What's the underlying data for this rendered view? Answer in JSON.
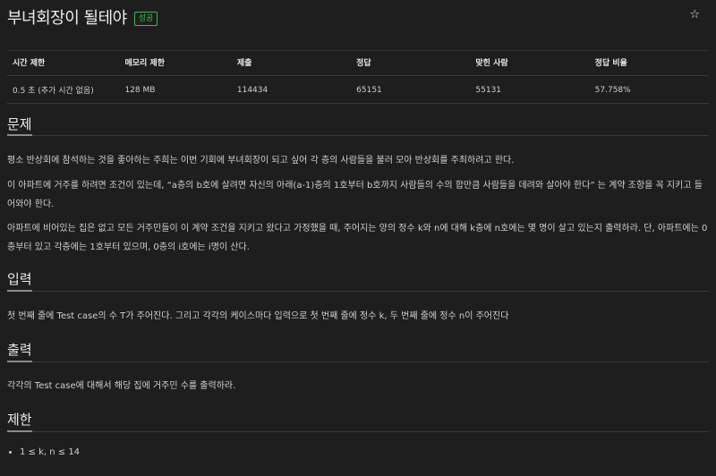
{
  "problem": {
    "title": "부녀회장이 될테야",
    "badge": "성공",
    "star_icon": "star-icon"
  },
  "stats": {
    "headers": [
      "시간 제한",
      "메모리 제한",
      "제출",
      "정답",
      "맞힌 사람",
      "정답 비율"
    ],
    "values": [
      "0.5 초 (추가 시간 없음)",
      "128 MB",
      "114434",
      "65151",
      "55131",
      "57.758%"
    ]
  },
  "sections": {
    "description": {
      "title": "문제",
      "paragraphs": [
        "평소 반상회에 참석하는 것을 좋아하는 주희는 이번 기회에 부녀회장이 되고 싶어 각 층의 사람들을 불러 모아 반상회를 주최하려고 한다.",
        "이 아파트에 거주를 하려면 조건이 있는데, “a층의 b호에 살려면 자신의 아래(a-1)층의 1호부터 b호까지 사람들의 수의 합만큼 사람들을 데려와 살아야 한다” 는 계약 조항을 꼭 지키고 들어와야 한다.",
        "아파트에 비어있는 집은 없고 모든 거주민들이 이 계약 조건을 지키고 왔다고 가정했을 때, 주어지는 양의 정수 k와 n에 대해 k층에 n호에는 몇 명이 살고 있는지 출력하라. 단, 아파트에는 0층부터 있고 각층에는 1호부터 있으며, 0층의 i호에는 i명이 산다."
      ]
    },
    "input": {
      "title": "입력",
      "text": "첫 번째 줄에 Test case의 수 T가 주어진다. 그리고 각각의 케이스마다 입력으로 첫 번째 줄에 정수 k, 두 번째 줄에 정수 n이 주어진다"
    },
    "output": {
      "title": "출력",
      "text": "각각의 Test case에 대해서 해당 집에 거주민 수를 출력하라."
    },
    "limits": {
      "title": "제한",
      "items": [
        "1 ≤ k, n ≤ 14"
      ]
    }
  }
}
